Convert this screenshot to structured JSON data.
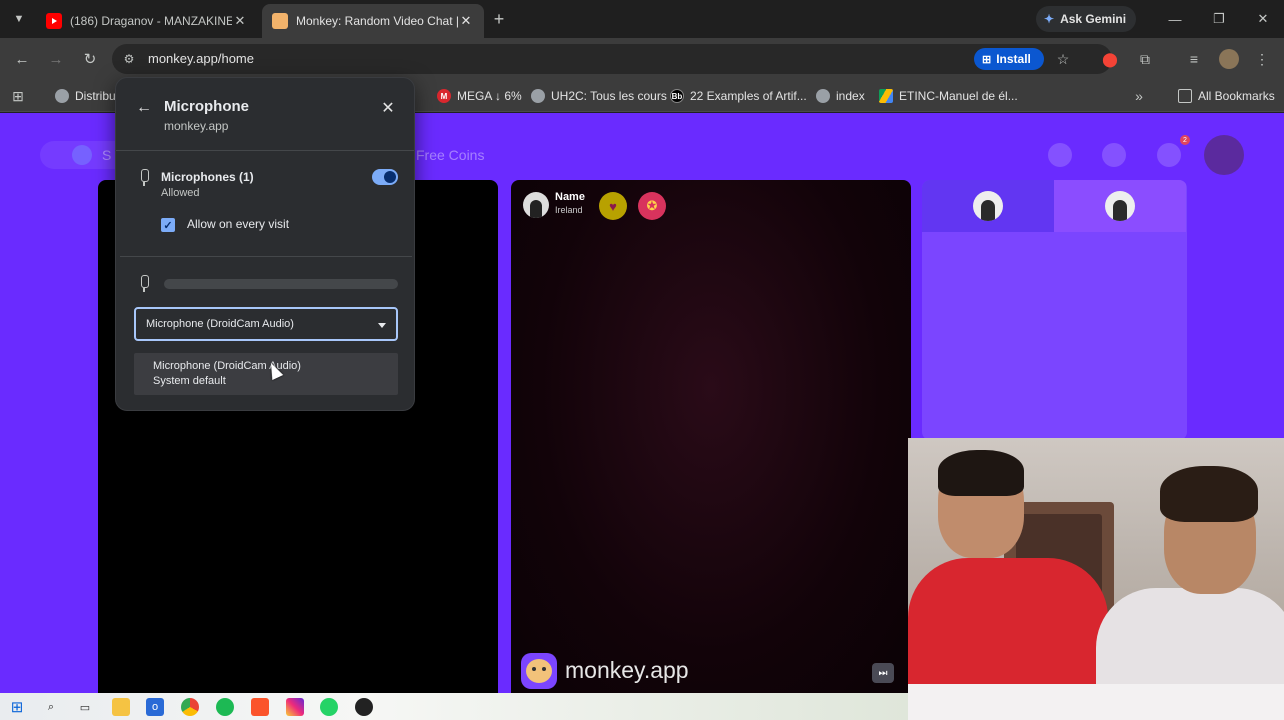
{
  "browser": {
    "tabs": [
      {
        "title": "(186) Draganov - MANZAKINE",
        "favicon": "youtube-icon",
        "active": false
      },
      {
        "title": "Monkey: Random Video Chat |",
        "favicon": "monkey-icon",
        "active": true
      }
    ],
    "ask_gemini": "Ask Gemini",
    "url": "monkey.app/home",
    "install_label": "Install"
  },
  "bookmarks": [
    {
      "label": "Distribu",
      "icon": "globe-icon"
    },
    {
      "label": "MEGA ↓ 6%",
      "icon": "mega-icon"
    },
    {
      "label": "UH2C: Tous les cours",
      "icon": "globe-icon"
    },
    {
      "label": "22 Examples of Artif...",
      "icon": "behance-icon"
    },
    {
      "label": "index",
      "icon": "globe-icon"
    },
    {
      "label": "ETINC-Manuel de él...",
      "icon": "drive-icon"
    }
  ],
  "all_bookmarks": "All Bookmarks",
  "page": {
    "free_coins": "Free Coins",
    "s_text": "S",
    "notification_count": "2",
    "peer": {
      "name": "Name",
      "country": "Ireland"
    },
    "brand": "monkey.app"
  },
  "popup": {
    "title": "Microphone",
    "site": "monkey.app",
    "microphones_label": "Microphones (1)",
    "status": "Allowed",
    "allow_every_visit": "Allow on every visit",
    "allow_every_visit_checked": true,
    "toggle_on": true,
    "mic_level": 0.0,
    "selected_device": "Microphone (DroidCam Audio)",
    "options": [
      {
        "line1": "Microphone (DroidCam Audio)",
        "line2": "System default"
      }
    ]
  },
  "colors": {
    "page_bg": "#6a2bff",
    "accent_blue": "#7cacf8",
    "install_blue": "#0b57d0"
  }
}
